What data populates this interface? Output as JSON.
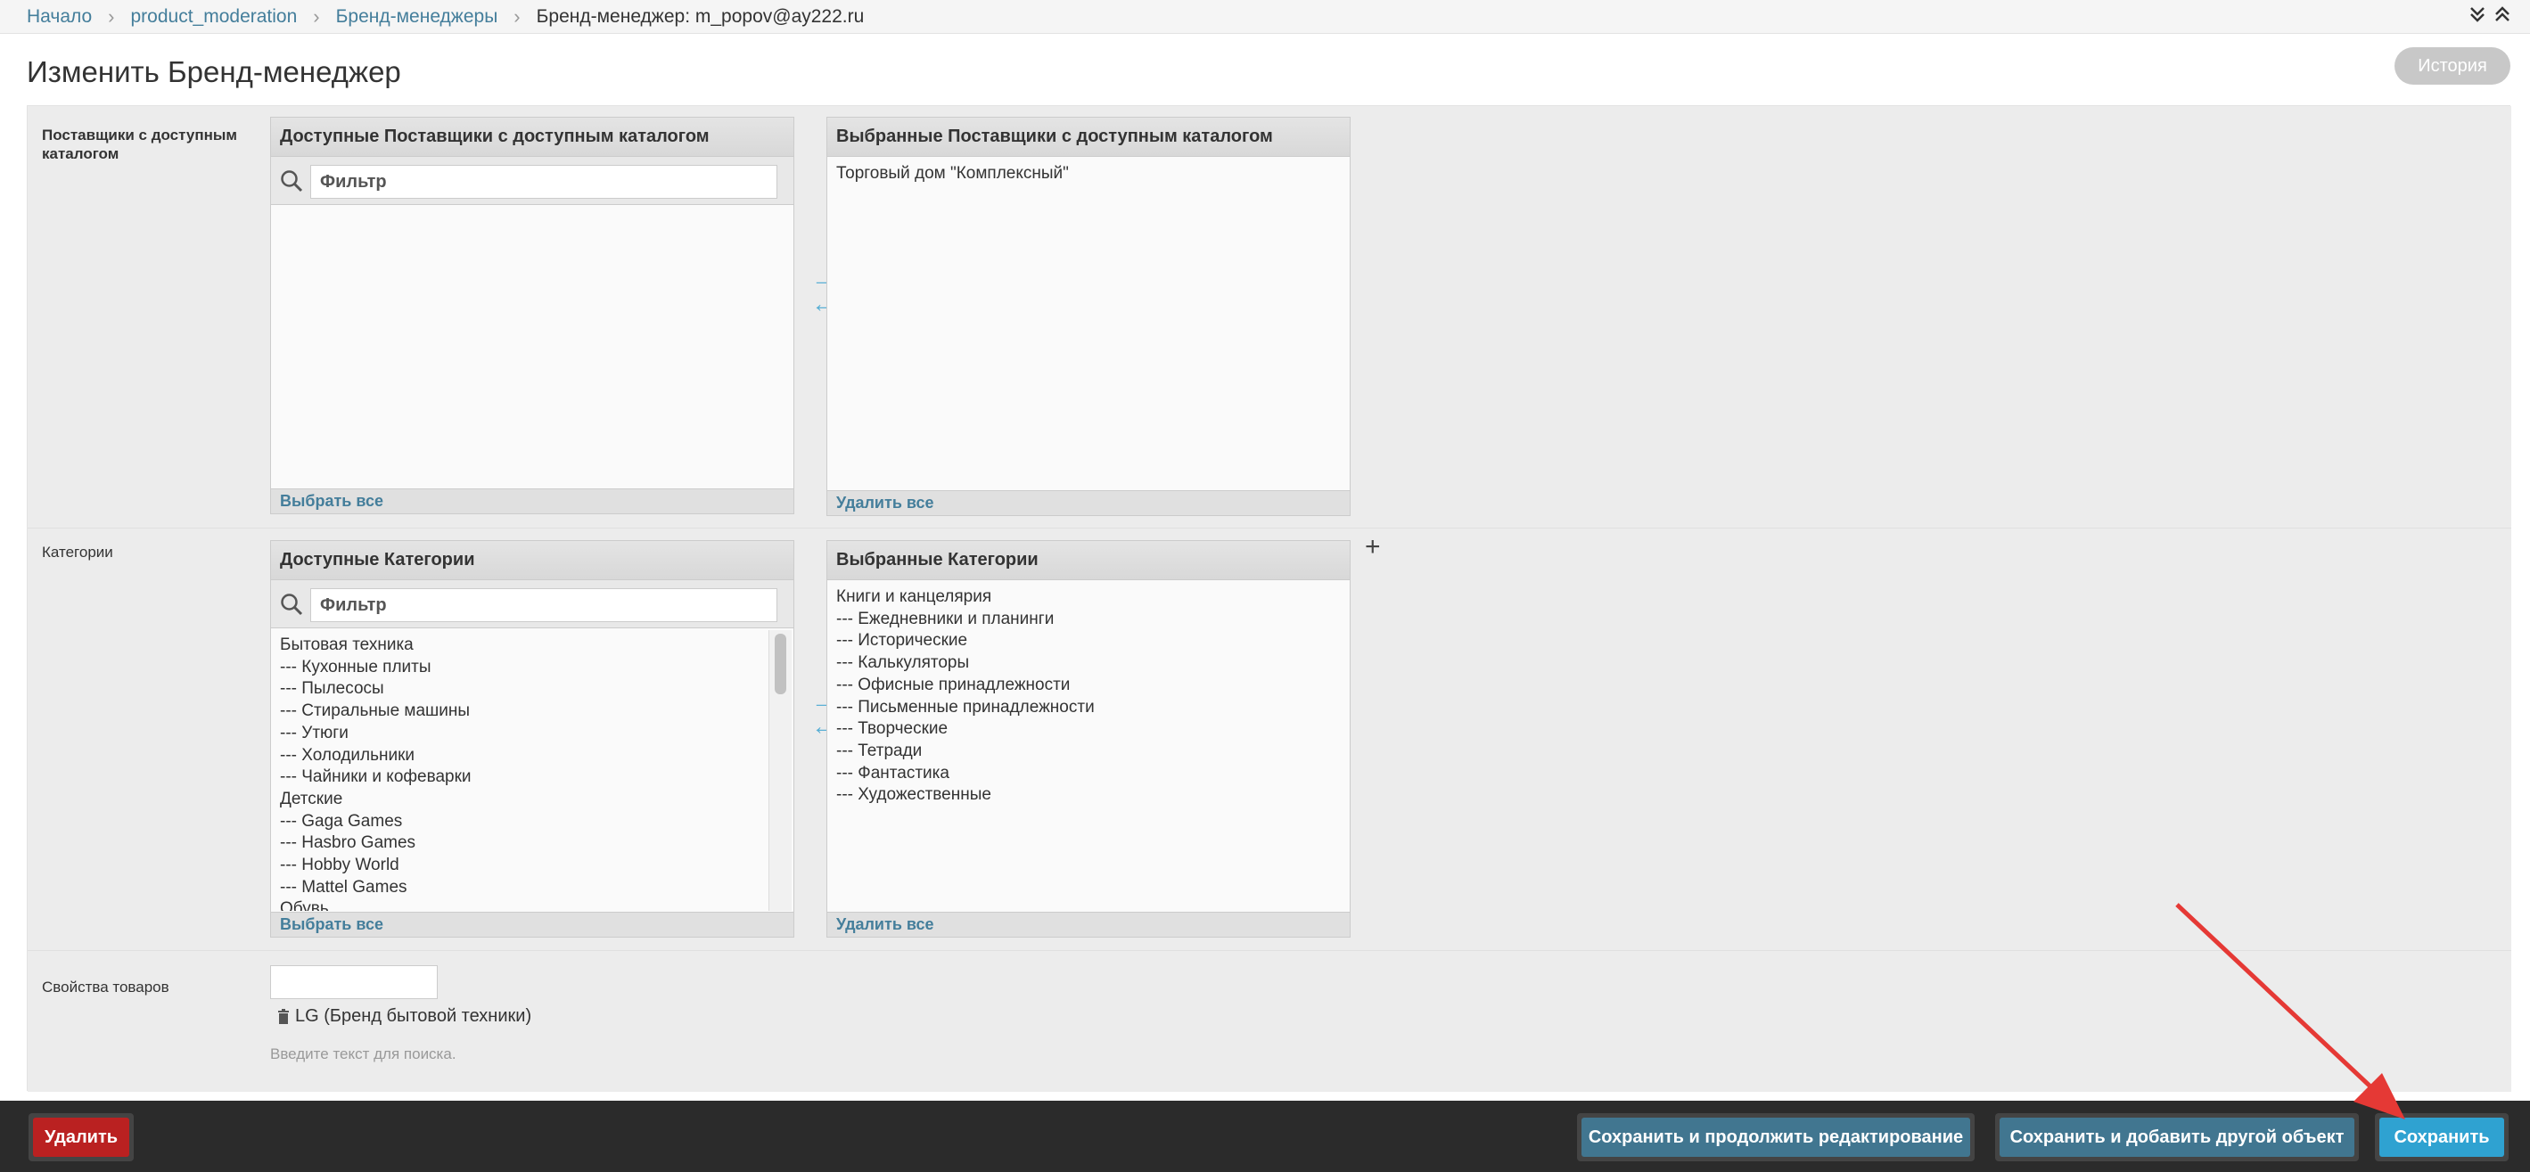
{
  "breadcrumb": {
    "home": "Начало",
    "app": "product_moderation",
    "model": "Бренд-менеджеры",
    "current": "Бренд-менеджер: m_popov@ay222.ru"
  },
  "page_title": "Изменить Бренд-менеджер",
  "history_label": "История",
  "suppliers": {
    "label": "Поставщики с доступным каталогом",
    "available_title": "Доступные Поставщики с доступным каталогом",
    "filter_placeholder": "Фильтр",
    "available_items": [],
    "select_all": "Выбрать все",
    "chosen_title": "Выбранные Поставщики с доступным каталогом",
    "chosen_items": [
      "Торговый дом \"Комплексный\""
    ],
    "remove_all": "Удалить все"
  },
  "categories": {
    "label": "Категории",
    "available_title": "Доступные Категории",
    "filter_placeholder": "Фильтр",
    "available_items": [
      "Бытовая техника",
      "--- Кухонные плиты",
      "--- Пылесосы",
      "--- Стиральные машины",
      "--- Утюги",
      "--- Холодильники",
      "--- Чайники и кофеварки",
      "Детские",
      "--- Gaga Games",
      "--- Hasbro Games",
      "--- Hobby World",
      "--- Mattel Games",
      "Обувь"
    ],
    "select_all": "Выбрать все",
    "chosen_title": "Выбранные Категории",
    "chosen_items": [
      "Книги и канцелярия",
      "--- Ежедневники и планинги",
      "--- Исторические",
      "--- Калькуляторы",
      "--- Офисные принадлежности",
      "--- Письменные принадлежности",
      "--- Творческие",
      "--- Тетради",
      "--- Фантастика",
      "--- Художественные"
    ],
    "remove_all": "Удалить все",
    "add_icon": "plus-icon"
  },
  "properties": {
    "label": "Свойства товаров",
    "tag": "LG (Бренд бытовой техники)",
    "tag_icon": "trash-icon",
    "help": "Введите текст для поиска."
  },
  "actions": {
    "delete": "Удалить",
    "save_continue": "Сохранить и продолжить редактирование",
    "save_add": "Сохранить и добавить другой объект",
    "save": "Сохранить"
  },
  "colors": {
    "link": "#447e9b",
    "delete": "#ba2121",
    "save": "#2fa2d1",
    "annotation_arrow": "#e53935"
  }
}
